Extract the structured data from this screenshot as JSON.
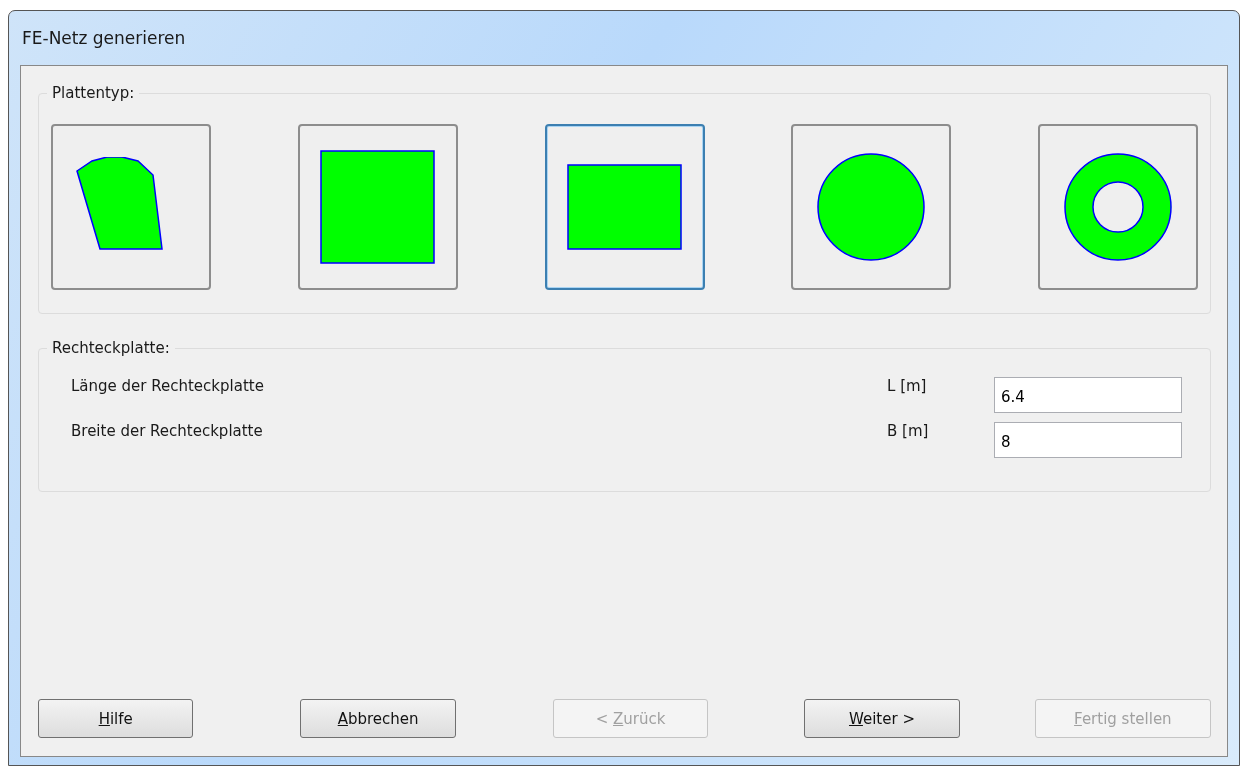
{
  "window": {
    "title": "FE-Netz generieren"
  },
  "plate_type": {
    "legend": "Plattentyp:",
    "options": [
      {
        "kind": "polygon",
        "selected": false
      },
      {
        "kind": "square",
        "selected": false
      },
      {
        "kind": "rectangle",
        "selected": true
      },
      {
        "kind": "circle",
        "selected": false
      },
      {
        "kind": "ring",
        "selected": false
      }
    ]
  },
  "rectangle_plate": {
    "legend": "Rechteckplatte:",
    "fields": [
      {
        "label": "Länge der Rechteckplatte",
        "unit": "L [m]",
        "value": "6.4"
      },
      {
        "label": "Breite der Rechteckplatte",
        "unit": "B [m]",
        "value": "8"
      }
    ]
  },
  "buttons": [
    {
      "label_parts": [
        {
          "text": "H",
          "underlined": true
        },
        {
          "text": "ilfe",
          "underlined": false
        }
      ],
      "disabled": false
    },
    {
      "label_parts": [
        {
          "text": "A",
          "underlined": true
        },
        {
          "text": "bbrechen",
          "underlined": false
        }
      ],
      "disabled": false
    },
    {
      "label_parts": [
        {
          "text": "< ",
          "underlined": false
        },
        {
          "text": "Z",
          "underlined": true
        },
        {
          "text": "urück",
          "underlined": false
        }
      ],
      "disabled": true
    },
    {
      "label_parts": [
        {
          "text": "W",
          "underlined": true
        },
        {
          "text": "eiter >",
          "underlined": false
        }
      ],
      "disabled": false
    },
    {
      "label_parts": [
        {
          "text": "F",
          "underlined": true
        },
        {
          "text": "ertig stellen",
          "underlined": false
        }
      ],
      "disabled": true
    }
  ]
}
